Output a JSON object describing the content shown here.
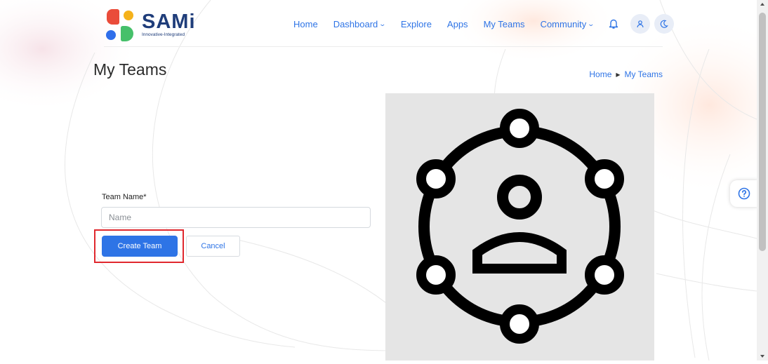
{
  "logo": {
    "name": "SAMi",
    "tagline": "Innovative-Integrated"
  },
  "nav": {
    "items": [
      {
        "label": "Home"
      },
      {
        "label": "Dashboard",
        "dropdown": true
      },
      {
        "label": "Explore"
      },
      {
        "label": "Apps"
      },
      {
        "label": "My Teams"
      },
      {
        "label": "Community",
        "dropdown": true
      }
    ],
    "icons": [
      "bell-icon",
      "user-icon",
      "moon-icon"
    ],
    "chevron": "⌄"
  },
  "page": {
    "title": "My Teams"
  },
  "breadcrumb": {
    "items": [
      "Home",
      "My Teams"
    ],
    "separator": "▶"
  },
  "form": {
    "team_name_label": "Team Name*",
    "team_name_placeholder": "Name",
    "team_name_value": "",
    "create_button": "Create Team",
    "cancel_button": "Cancel"
  },
  "illustration": {
    "icon": "team-network-icon"
  },
  "help": {
    "icon": "question-circle-icon"
  },
  "colors": {
    "accent": "#2e74e6",
    "highlight": "#e0282e",
    "brand_text": "#1f3d7a",
    "logo_red": "#ea4c3a",
    "logo_yellow": "#f5b21b",
    "logo_blue": "#2f6fea",
    "logo_green": "#46c06a"
  }
}
